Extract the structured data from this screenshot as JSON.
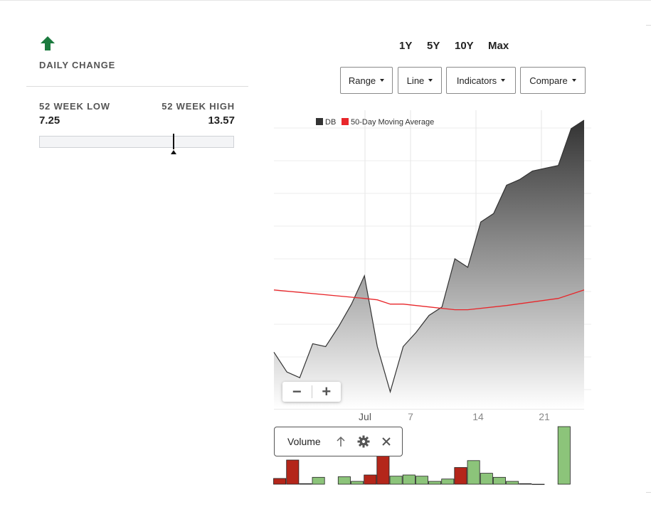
{
  "summary": {
    "daily_change_label": "DAILY CHANGE",
    "week52_low_label": "52 WEEK LOW",
    "week52_low_value": "7.25",
    "week52_high_label": "52 WEEK HIGH",
    "week52_high_value": "13.57",
    "up_color": "#1b7a3e"
  },
  "periods": [
    "1Y",
    "5Y",
    "10Y",
    "Max"
  ],
  "dropdowns": [
    "Range",
    "Line",
    "Indicators",
    "Compare"
  ],
  "zoom": {
    "minus": "−",
    "plus": "+"
  },
  "volume_panel": {
    "label": "Volume"
  },
  "colors": {
    "price_line": "#333333",
    "moving_average": "#e8262a",
    "volume_up": "#8cc47a",
    "volume_down": "#b4261a"
  },
  "chart_data": {
    "type": "area",
    "legend": [
      {
        "name": "DB",
        "color": "#333333"
      },
      {
        "name": "50-Day Moving Average",
        "color": "#e8262a"
      }
    ],
    "x_ticks": [
      "Jul",
      "7",
      "14",
      "21"
    ],
    "ylim": [
      0,
      100
    ],
    "grid": true,
    "series": [
      {
        "name": "DB",
        "x": [
          0,
          1,
          2,
          3,
          4,
          5,
          6,
          7,
          8,
          9,
          10,
          11,
          12,
          13,
          14,
          15,
          16,
          17,
          18,
          19,
          20,
          21,
          22,
          23,
          24
        ],
        "values": [
          17,
          10,
          8,
          20,
          19,
          26,
          34,
          44,
          19,
          3,
          19,
          24,
          30,
          33,
          50,
          47,
          63,
          66,
          76,
          78,
          81,
          82,
          83,
          96,
          99
        ]
      },
      {
        "name": "50-Day Moving Average",
        "x": [
          0,
          7,
          8,
          9,
          10,
          12,
          14,
          15,
          18,
          22,
          24
        ],
        "values": [
          39,
          36,
          35.5,
          34,
          34,
          33,
          32,
          32,
          33.5,
          36,
          39
        ]
      }
    ],
    "volume": {
      "x": [
        0,
        1,
        2,
        3,
        5,
        6,
        7,
        8,
        9,
        10,
        11,
        12,
        13,
        14,
        15,
        16,
        17,
        18,
        19,
        20,
        22
      ],
      "values": [
        10,
        42,
        1,
        12,
        13,
        5,
        16,
        83,
        14,
        16,
        14,
        5,
        9,
        29,
        41,
        19,
        12,
        5,
        1,
        0,
        100
      ],
      "direction": [
        "down",
        "down",
        "up",
        "up",
        "up",
        "up",
        "down",
        "down",
        "up",
        "up",
        "up",
        "up",
        "up",
        "down",
        "up",
        "up",
        "up",
        "up",
        "up",
        "up",
        "up"
      ]
    }
  }
}
